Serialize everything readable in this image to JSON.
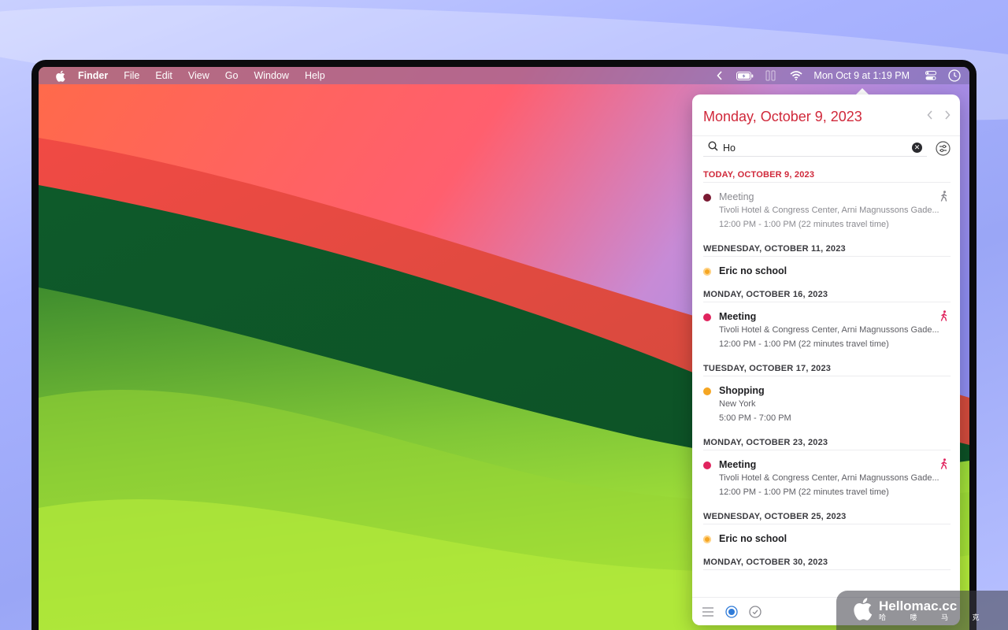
{
  "menubar": {
    "app_name": "Finder",
    "items": [
      "File",
      "Edit",
      "View",
      "Go",
      "Window",
      "Help"
    ],
    "clock": "Mon Oct 9 at 1:19 PM",
    "icons": [
      "apple-icon",
      "chevron-left-icon",
      "battery-charging-icon",
      "stage-manager-icon",
      "wifi-icon",
      "control-center-icon",
      "clock-icon"
    ]
  },
  "calendar": {
    "header_date": "Monday, October 9, 2023",
    "search_value": "Ho",
    "days": [
      {
        "label": "TODAY, OCTOBER 9, 2023",
        "today": true,
        "events": [
          {
            "title": "Meeting",
            "location": "Tivoli Hotel & Congress Center, Arni Magnussons Gade...",
            "time": "12:00 PM - 1:00 PM (22 minutes travel time)",
            "color": "#7a1a33",
            "past": true,
            "travel": true
          }
        ]
      },
      {
        "label": "WEDNESDAY, OCTOBER 11, 2023",
        "events": [
          {
            "title": "Eric no school",
            "color": "#f5a623",
            "ring": true
          }
        ]
      },
      {
        "label": "MONDAY, OCTOBER 16, 2023",
        "events": [
          {
            "title": "Meeting",
            "location": "Tivoli Hotel & Congress Center, Arni Magnussons Gade...",
            "time": "12:00 PM - 1:00 PM (22 minutes travel time)",
            "color": "#e0245e",
            "travel": true
          }
        ]
      },
      {
        "label": "TUESDAY, OCTOBER 17, 2023",
        "events": [
          {
            "title": "Shopping",
            "location": "New York",
            "time": "5:00 PM - 7:00 PM",
            "color": "#f5a623"
          }
        ]
      },
      {
        "label": "MONDAY, OCTOBER 23, 2023",
        "events": [
          {
            "title": "Meeting",
            "location": "Tivoli Hotel & Congress Center, Arni Magnussons Gade...",
            "time": "12:00 PM - 1:00 PM (22 minutes travel time)",
            "color": "#e0245e",
            "travel": true
          }
        ]
      },
      {
        "label": "WEDNESDAY, OCTOBER 25, 2023",
        "events": [
          {
            "title": "Eric no school",
            "color": "#f5a623",
            "ring": true
          }
        ]
      },
      {
        "label": "MONDAY, OCTOBER 30, 2023",
        "events": []
      }
    ],
    "colors": {
      "accent": "#d0283a",
      "meeting_past": "#7a1a33",
      "meeting": "#e0245e",
      "orange": "#f5a623"
    }
  },
  "watermark": {
    "main": "Hellomac.cc",
    "sub": "哈 喽 马 克"
  }
}
